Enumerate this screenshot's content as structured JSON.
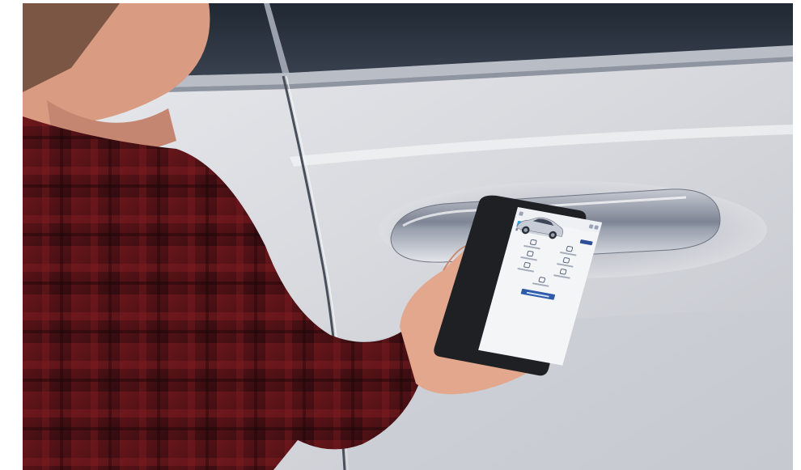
{
  "scene": {
    "description_colors": {
      "car_paint": "#dfe1e6",
      "shirt_red": "#8e1f24",
      "skin": "#e3a88d",
      "phone_body": "#1f2024",
      "app_accent": "#2e5aa8"
    }
  },
  "phone_app": {
    "header": {
      "title": "",
      "menu_icon": "menu-icon",
      "notification_icon": "bell-icon",
      "settings_icon": "gear-icon"
    },
    "vehicle": {
      "subtitle": "",
      "name": "",
      "trim": ""
    },
    "tiles": [
      {
        "icon": "lock-icon"
      },
      {
        "icon": "unlock-icon"
      },
      {
        "icon": "engine-start-icon"
      },
      {
        "icon": "car-finder-icon"
      },
      {
        "icon": "climate-icon"
      },
      {
        "icon": "alert-icon"
      },
      {
        "icon": "horn-icon"
      }
    ],
    "cta_label": ""
  }
}
